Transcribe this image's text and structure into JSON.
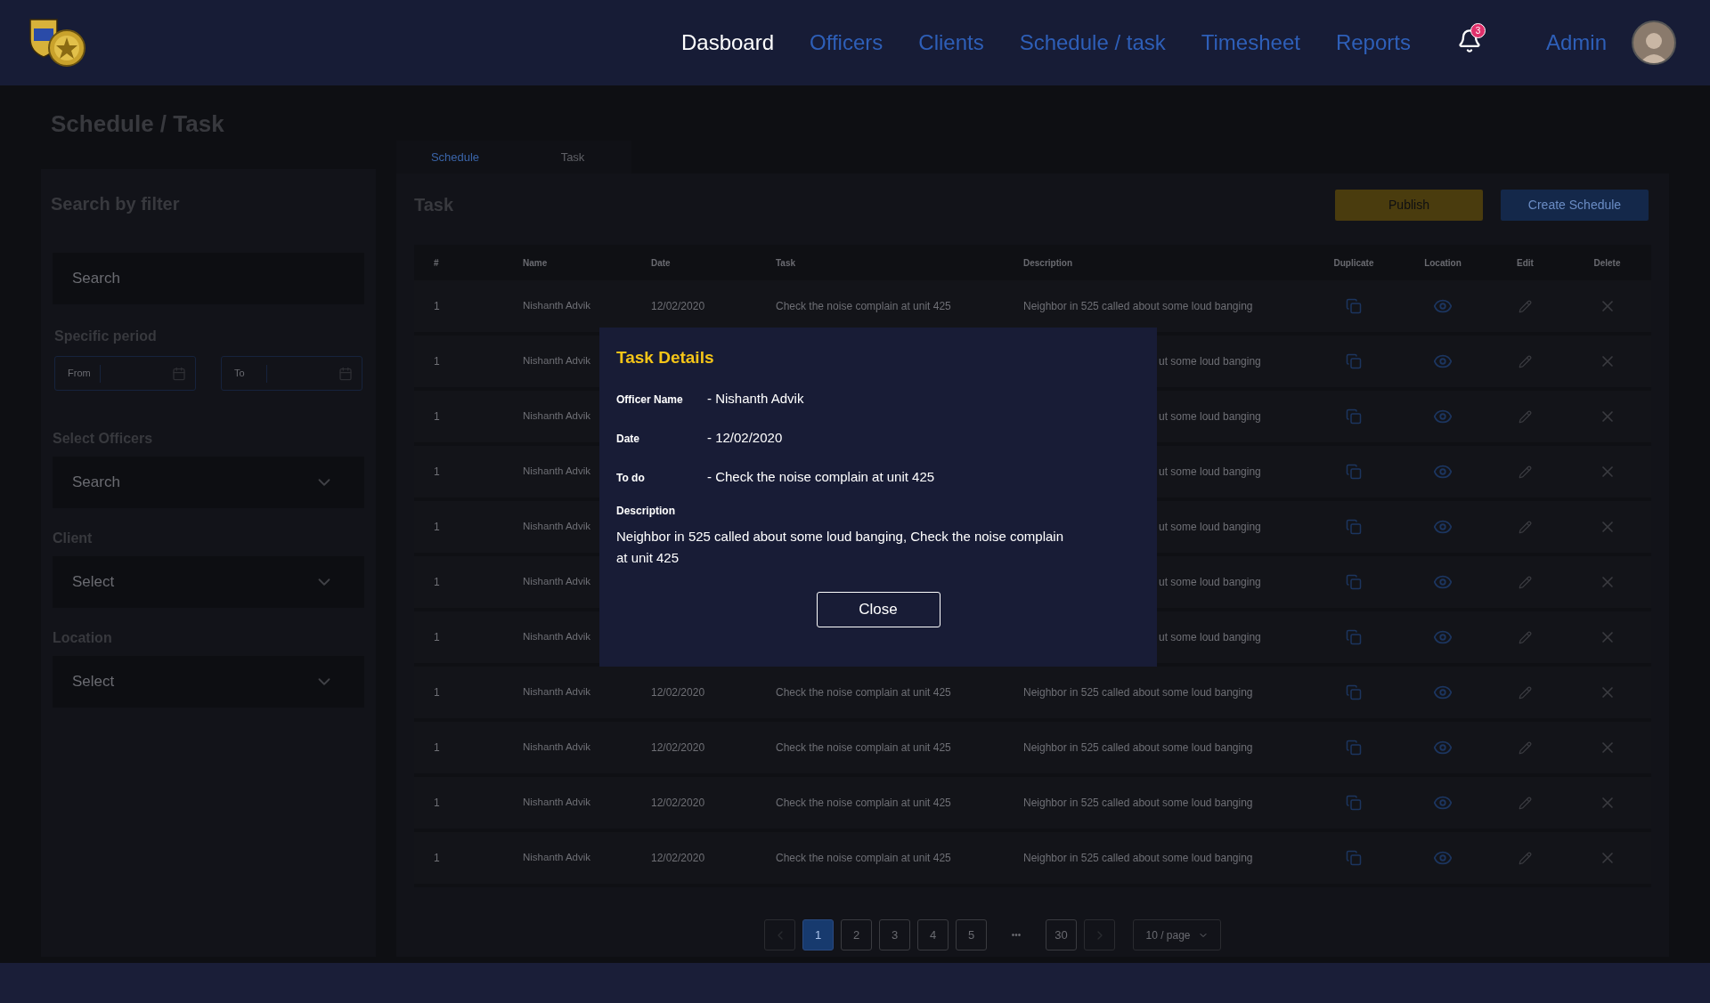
{
  "header": {
    "nav": [
      {
        "label": "Dasboard",
        "selected": true
      },
      {
        "label": "Officers",
        "selected": false
      },
      {
        "label": "Clients",
        "selected": false
      },
      {
        "label": "Schedule / task",
        "selected": false
      },
      {
        "label": "Timesheet",
        "selected": false
      },
      {
        "label": "Reports",
        "selected": false
      }
    ],
    "notifications": "3",
    "user": "Admin"
  },
  "page_title": "Schedule / Task",
  "filters": {
    "title": "Search by filter",
    "search": {
      "placeholder": "Search"
    },
    "period": {
      "label": "Specific period",
      "from": "From",
      "to": "To"
    },
    "officers": {
      "label": "Select Officers",
      "placeholder": "Search"
    },
    "client": {
      "label": "Client",
      "placeholder": "Select"
    },
    "location": {
      "label": "Location",
      "placeholder": "Select"
    }
  },
  "tabs": [
    {
      "label": "Schedule",
      "selected": true
    },
    {
      "label": "Task",
      "selected": false
    }
  ],
  "panel": {
    "title": "Task",
    "buttons": [
      {
        "label": "Publish",
        "kind": "warning"
      },
      {
        "label": "Create Schedule",
        "kind": "primary"
      }
    ]
  },
  "table": {
    "columns": [
      "#",
      "Name",
      "Date",
      "Task",
      "Description",
      "Duplicate",
      "Location",
      "Edit",
      "Delete"
    ],
    "rows": [
      {
        "number": "1",
        "name": "Nishanth Advik",
        "date": "12/02/2020",
        "task": "Check the noise complain at unit 425",
        "description": "Neighbor in 525 called about some loud banging"
      },
      {
        "number": "1",
        "name": "Nishanth Advik",
        "description": "ut some loud banging"
      },
      {
        "number": "1",
        "name": "Nishanth Advik",
        "description": "ut some loud banging"
      },
      {
        "number": "1",
        "name": "Nishanth Advik",
        "description": "ut some loud banging"
      },
      {
        "number": "1",
        "name": "Nishanth Advik",
        "description": "ut some loud banging"
      },
      {
        "number": "1",
        "name": "Nishanth Advik",
        "description": "ut some loud banging"
      },
      {
        "number": "1",
        "name": "Nishanth Advik",
        "description": "ut some loud banging"
      },
      {
        "number": "1",
        "name": "Nishanth Advik",
        "date": "12/02/2020",
        "task": "Check the noise complain at unit 425",
        "description": "Neighbor in 525 called about some loud banging"
      },
      {
        "number": "1",
        "name": "Nishanth Advik",
        "date": "12/02/2020",
        "task": "Check the noise complain at unit 425",
        "description": "Neighbor in 525 called about some loud banging"
      },
      {
        "number": "1",
        "name": "Nishanth Advik",
        "date": "12/02/2020",
        "task": "Check the noise complain at unit 425",
        "description": "Neighbor in 525 called about some loud banging"
      },
      {
        "number": "1",
        "name": "Nishanth Advik",
        "date": "12/02/2020",
        "task": "Check the noise complain at unit 425",
        "description": "Neighbor in 525 called about some loud banging"
      }
    ]
  },
  "pagination": {
    "pages": [
      {
        "label": "1",
        "kind": "page",
        "selected": true
      },
      {
        "label": "2",
        "kind": "page",
        "selected": false
      },
      {
        "label": "3",
        "kind": "page",
        "selected": false
      },
      {
        "label": "4",
        "kind": "page",
        "selected": false
      },
      {
        "label": "5",
        "kind": "page",
        "selected": false
      },
      {
        "label": "•••",
        "kind": "ellipsis"
      },
      {
        "label": "30",
        "kind": "page",
        "selected": false
      }
    ],
    "page_size": "10 / page"
  },
  "modal": {
    "title": "Task Details",
    "fields": [
      {
        "label": "Officer Name",
        "value": "- Nishanth Advik"
      },
      {
        "label": "Date",
        "value": "- 12/02/2020"
      },
      {
        "label": "To do",
        "value": "- Check the noise complain at unit 425"
      }
    ],
    "description_label": "Description",
    "description": "Neighbor in 525 called about some loud banging, Check the noise complain at unit 425",
    "close": "Close"
  }
}
